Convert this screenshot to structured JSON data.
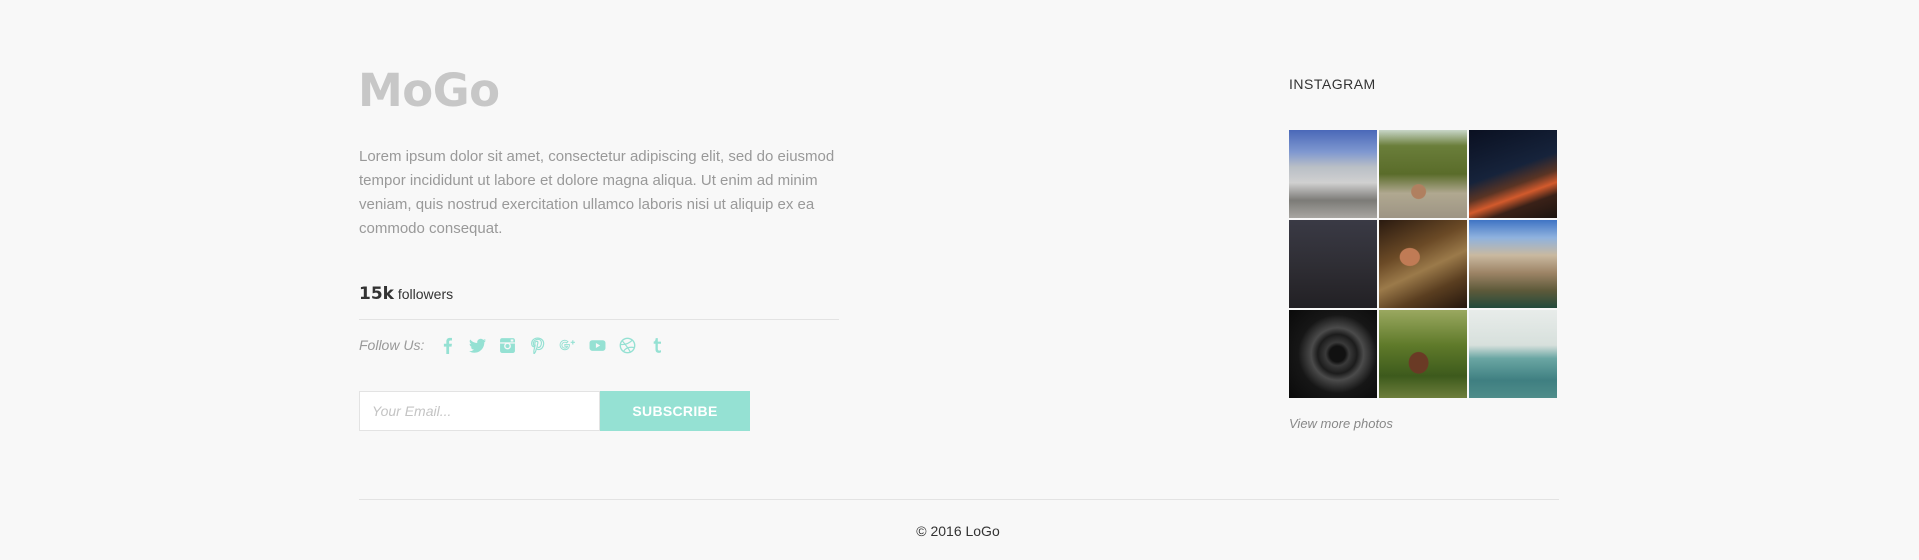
{
  "brand": {
    "logo": "MoGo"
  },
  "about": {
    "text": "Lorem ipsum dolor sit amet, consectetur adipiscing elit, sed do eiusmod tempor incididunt ut labore et dolore magna aliqua. Ut enim ad minim veniam, quis nostrud exercitation ullamco laboris nisi ut aliquip ex ea commodo consequat.",
    "followers_count": "15k",
    "followers_label": "followers"
  },
  "follow": {
    "label": "Follow Us:",
    "icons": [
      "facebook-icon",
      "twitter-icon",
      "instagram-icon",
      "pinterest-icon",
      "google-plus-icon",
      "youtube-icon",
      "dribbble-icon",
      "tumblr-icon"
    ],
    "icon_color": "#95e1d3"
  },
  "subscribe": {
    "email_placeholder": "Your Email...",
    "button_label": "SUBSCRIBE",
    "button_color": "#95e1d3"
  },
  "instagram": {
    "title": "INSTAGRAM",
    "photos": [
      "granite-dome-photo",
      "mountain-couple-photo",
      "night-highway-photo",
      "night-sky-photo",
      "feet-wood-photo",
      "rocky-peaks-photo",
      "tunnel-photo",
      "pine-cone-photo",
      "ocean-photo"
    ],
    "view_more": "View more photos"
  },
  "footer": {
    "copyright": "© 2016 LoGo"
  }
}
